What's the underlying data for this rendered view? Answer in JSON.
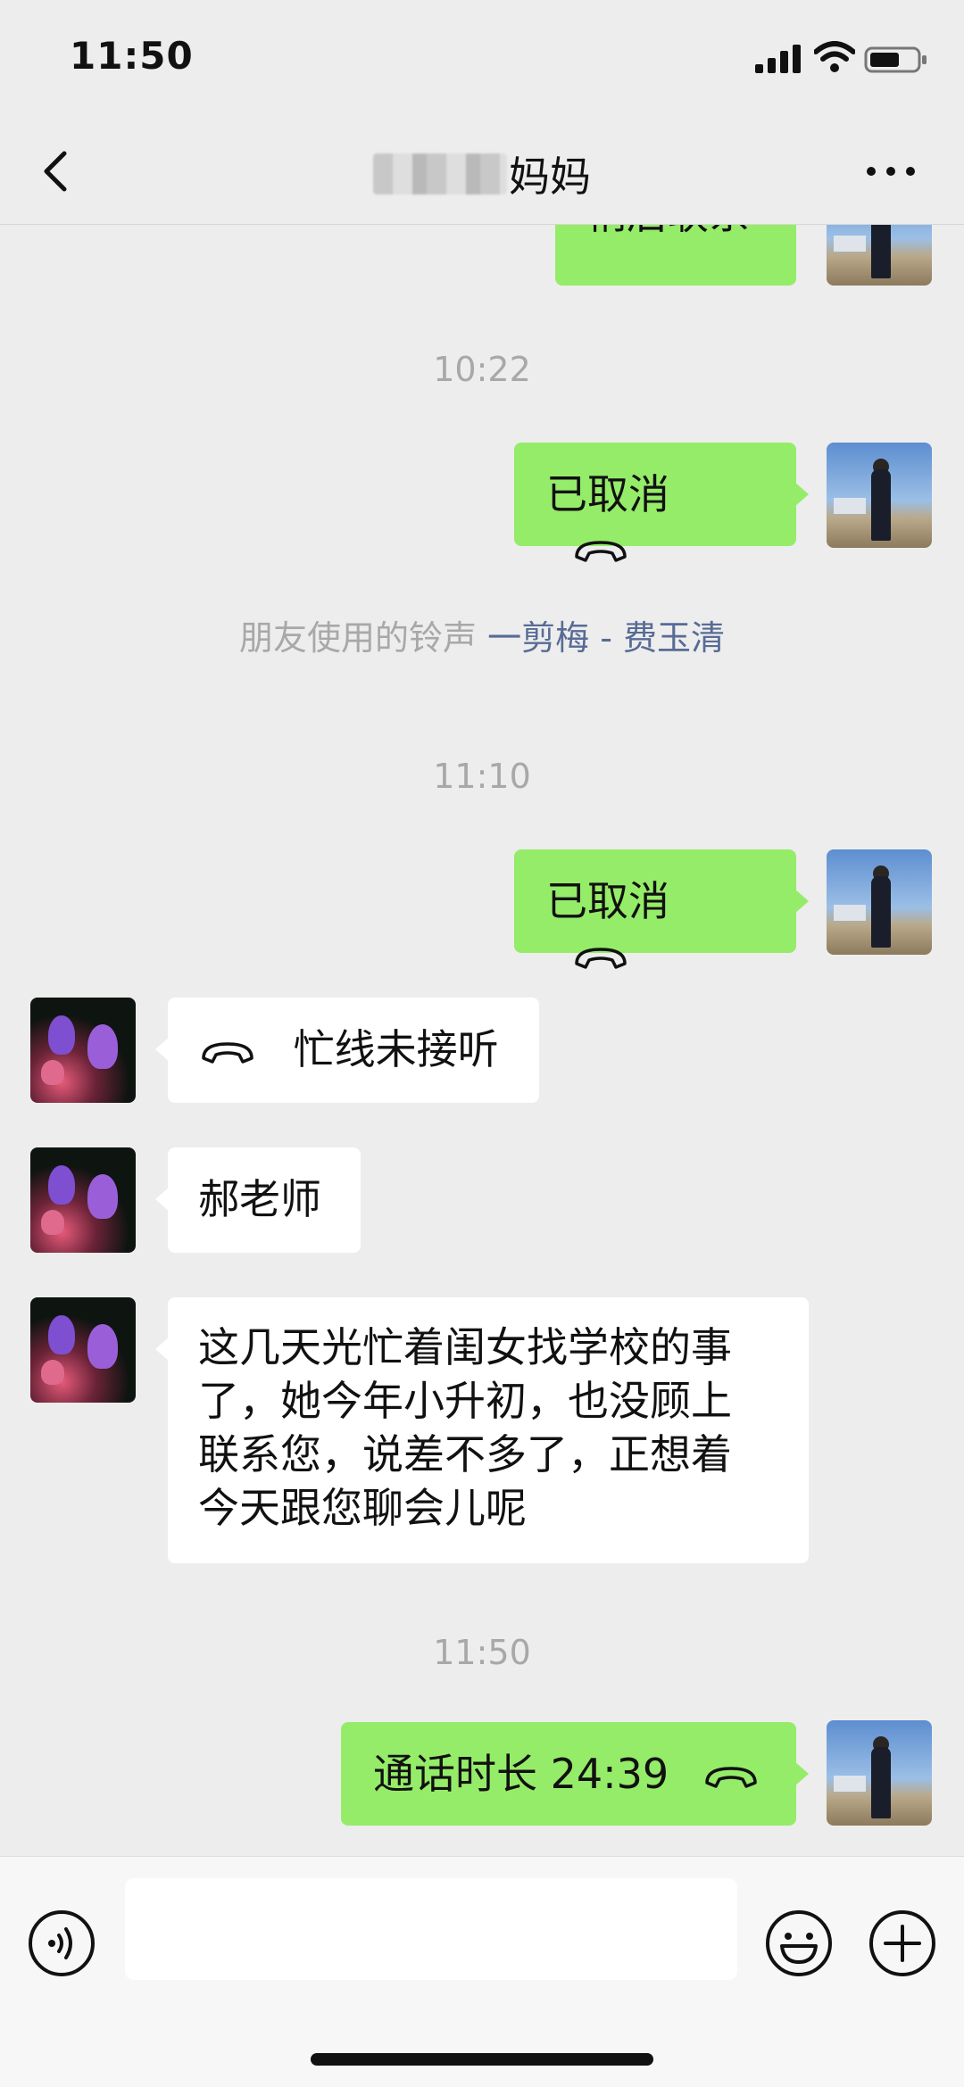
{
  "status_bar": {
    "time": "11:50"
  },
  "nav": {
    "title": "妈妈"
  },
  "messages": {
    "m0": {
      "text": "稍后联系"
    },
    "ts1": "10:22",
    "m1": {
      "text": "已取消"
    },
    "ringtone": {
      "prefix": "朋友使用的铃声 ",
      "song": "一剪梅 - 费玉清"
    },
    "ts2": "11:10",
    "m2": {
      "text": "已取消"
    },
    "m3": {
      "text": "忙线未接听"
    },
    "m4": {
      "text": "郝老师"
    },
    "m5": {
      "lines": [
        "这几天光忙着闺女找学校的事",
        "了，她今年小升初，也没顾上",
        "联系您，说差不多了，正想着",
        "今天跟您聊会儿呢"
      ]
    },
    "ts3": "11:50",
    "m6": {
      "text": "通话时长 24:39"
    }
  },
  "input": {
    "value": "",
    "placeholder": ""
  },
  "colors": {
    "outgoing_bubble": "#95ec69",
    "incoming_bubble": "#ffffff",
    "background": "#ededed",
    "link": "#576b95"
  },
  "icons": [
    "back-icon",
    "more-icon",
    "phone-icon",
    "voice-icon",
    "emoji-icon",
    "plus-icon",
    "signal-icon",
    "wifi-icon",
    "battery-icon"
  ]
}
